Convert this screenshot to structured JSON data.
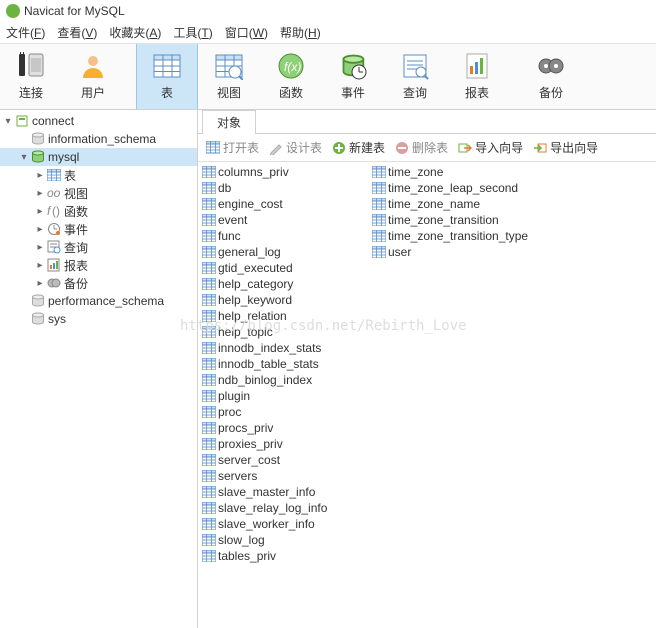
{
  "app_title": "Navicat for MySQL",
  "menubar": [
    {
      "label": "文件",
      "key": "F"
    },
    {
      "label": "查看",
      "key": "V"
    },
    {
      "label": "收藏夹",
      "key": "A"
    },
    {
      "label": "工具",
      "key": "T"
    },
    {
      "label": "窗口",
      "key": "W"
    },
    {
      "label": "帮助",
      "key": "H"
    }
  ],
  "toolbar": [
    {
      "name": "connect",
      "label": "连接"
    },
    {
      "name": "user",
      "label": "用户"
    },
    {
      "name": "table",
      "label": "表",
      "selected": true
    },
    {
      "name": "view",
      "label": "视图"
    },
    {
      "name": "function",
      "label": "函数"
    },
    {
      "name": "event",
      "label": "事件"
    },
    {
      "name": "query",
      "label": "查询"
    },
    {
      "name": "report",
      "label": "报表"
    },
    {
      "name": "backup",
      "label": "备份"
    }
  ],
  "tree": {
    "root": {
      "label": "connect"
    },
    "dbs": [
      {
        "label": "information_schema",
        "open": false
      },
      {
        "label": "mysql",
        "open": true,
        "selected": true,
        "children": [
          {
            "label": "表",
            "icon": "table"
          },
          {
            "label": "视图",
            "icon": "view"
          },
          {
            "label": "函数",
            "icon": "function"
          },
          {
            "label": "事件",
            "icon": "event"
          },
          {
            "label": "查询",
            "icon": "query"
          },
          {
            "label": "报表",
            "icon": "report"
          },
          {
            "label": "备份",
            "icon": "backup"
          }
        ]
      },
      {
        "label": "performance_schema",
        "open": false
      },
      {
        "label": "sys",
        "open": false
      }
    ]
  },
  "tab_label": "对象",
  "objbar": [
    {
      "name": "open-table",
      "label": "打开表",
      "enabled": false
    },
    {
      "name": "design-table",
      "label": "设计表",
      "enabled": false
    },
    {
      "name": "new-table",
      "label": "新建表",
      "enabled": true
    },
    {
      "name": "delete-table",
      "label": "删除表",
      "enabled": false
    },
    {
      "name": "import-wizard",
      "label": "导入向导",
      "enabled": true
    },
    {
      "name": "export-wizard",
      "label": "导出向导",
      "enabled": true
    }
  ],
  "tables_col1": [
    "columns_priv",
    "db",
    "engine_cost",
    "event",
    "func",
    "general_log",
    "gtid_executed",
    "help_category",
    "help_keyword",
    "help_relation",
    "help_topic",
    "innodb_index_stats",
    "innodb_table_stats",
    "ndb_binlog_index",
    "plugin",
    "proc",
    "procs_priv",
    "proxies_priv",
    "server_cost",
    "servers",
    "slave_master_info",
    "slave_relay_log_info",
    "slave_worker_info",
    "slow_log",
    "tables_priv"
  ],
  "tables_col2": [
    "time_zone",
    "time_zone_leap_second",
    "time_zone_name",
    "time_zone_transition",
    "time_zone_transition_type",
    "user"
  ],
  "watermark": "https://blog.csdn.net/Rebirth_Love"
}
